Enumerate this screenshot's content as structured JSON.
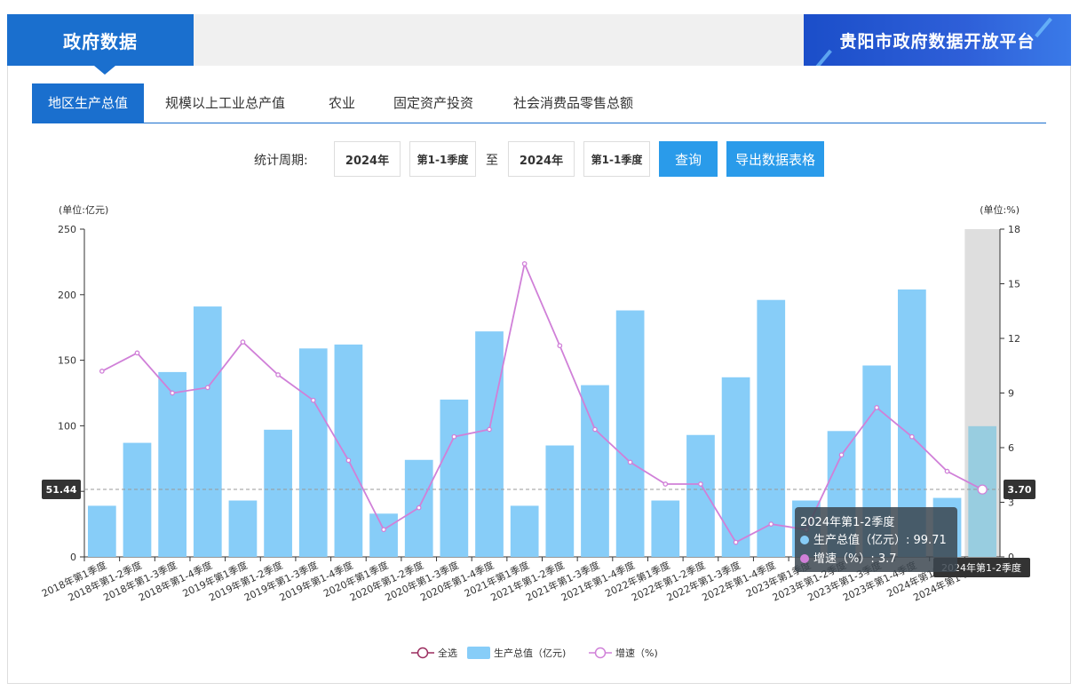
{
  "header": {
    "left_title": "政府数据",
    "right_title": "贵阳市政府数据开放平台"
  },
  "tabs": [
    {
      "label": "地区生产总值",
      "active": true
    },
    {
      "label": "规模以上工业总产值",
      "active": false
    },
    {
      "label": "农业",
      "active": false
    },
    {
      "label": "固定资产投资",
      "active": false
    },
    {
      "label": "社会消费品零售总额",
      "active": false
    }
  ],
  "filter": {
    "label": "统计周期:",
    "from_year": "2024年",
    "from_quarter": "第1-1季度",
    "to_label": "至",
    "to_year": "2024年",
    "to_quarter": "第1-1季度",
    "query_button": "查询",
    "export_button": "导出数据表格"
  },
  "colors": {
    "bar": "#87cdf8",
    "bar_highlight": "#98cde0",
    "line": "#d080d8",
    "primary": "#1a6fce",
    "button": "#2a9bea"
  },
  "chart_data": {
    "type": "bar",
    "left_unit": "(单位:亿元)",
    "right_unit": "(单位:%)",
    "ylim_left": [
      0,
      250
    ],
    "yticks_left": [
      0,
      50,
      100,
      150,
      200,
      250
    ],
    "ylim_right": [
      0,
      18
    ],
    "yticks_right": [
      0,
      3,
      6,
      9,
      12,
      15,
      18
    ],
    "categories": [
      "2018年第1季度",
      "2018年第1-2季度",
      "2018年第1-3季度",
      "2018年第1-4季度",
      "2019年第1季度",
      "2019年第1-2季度",
      "2019年第1-3季度",
      "2019年第1-4季度",
      "2020年第1季度",
      "2020年第1-2季度",
      "2020年第1-3季度",
      "2020年第1-4季度",
      "2021年第1季度",
      "2021年第1-2季度",
      "2021年第1-3季度",
      "2021年第1-4季度",
      "2022年第1季度",
      "2022年第1-2季度",
      "2022年第1-3季度",
      "2022年第1-4季度",
      "2023年第1季度",
      "2023年第1-2季度",
      "2023年第1-3季度",
      "2023年第1-4季度",
      "2024年第1季度",
      "2024年第1-2季度"
    ],
    "series": [
      {
        "name": "生产总值（亿元)",
        "axis": "left",
        "values": [
          39,
          87,
          141,
          191,
          43,
          97,
          159,
          162,
          33,
          74,
          120,
          172,
          39,
          85,
          131,
          188,
          43,
          93,
          137,
          196,
          43,
          96,
          146,
          204,
          45,
          99.71
        ]
      },
      {
        "name": "增速（%)",
        "axis": "right",
        "values": [
          10.2,
          11.2,
          9.0,
          9.3,
          11.8,
          10.0,
          8.6,
          5.3,
          1.5,
          2.7,
          6.6,
          7.0,
          16.1,
          11.6,
          7.0,
          5.2,
          4.0,
          4.0,
          0.8,
          1.8,
          1.5,
          5.6,
          8.2,
          6.6,
          4.7,
          3.7
        ]
      }
    ],
    "legend": [
      {
        "name": "全选"
      },
      {
        "name": "生产总值（亿元)"
      },
      {
        "name": "增速（%)"
      }
    ],
    "crosshair": {
      "left_value": "51.44",
      "right_value": "3.70",
      "category_label": "2024年第1-2季度",
      "index": 25
    },
    "tooltip": {
      "title": "2024年第1-2季度",
      "line1": "生产总值（亿元）: 99.71",
      "line2": "增速（%）: 3.7"
    }
  }
}
